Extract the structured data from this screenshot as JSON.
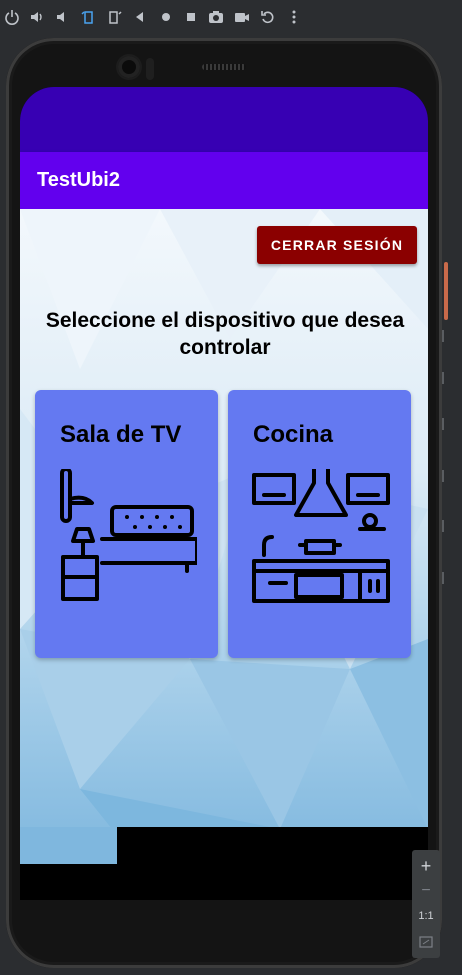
{
  "emulator_toolbar": {
    "icons": [
      "power-icon",
      "volume-up-icon",
      "volume-down-icon",
      "rotate-left-icon",
      "rotate-right-icon",
      "back-icon",
      "home-icon",
      "overview-icon",
      "camera-icon",
      "video-icon",
      "replay-icon",
      "more-icon"
    ]
  },
  "app": {
    "title": "TestUbi2",
    "logout_label": "CERRAR SESIÓN",
    "prompt": "Seleccione el dispositivo que desea controlar",
    "cards": [
      {
        "label": "Sala de TV",
        "icon": "bedroom-icon"
      },
      {
        "label": "Cocina",
        "icon": "kitchen-icon"
      }
    ],
    "colors": {
      "status_bar": "#3700b3",
      "app_bar": "#6200ee",
      "logout_button": "#8b0000",
      "card": "#6479f1"
    }
  },
  "zoom_panel": {
    "zoom_in": "+",
    "zoom_out": "−",
    "actual_size": "1:1"
  }
}
